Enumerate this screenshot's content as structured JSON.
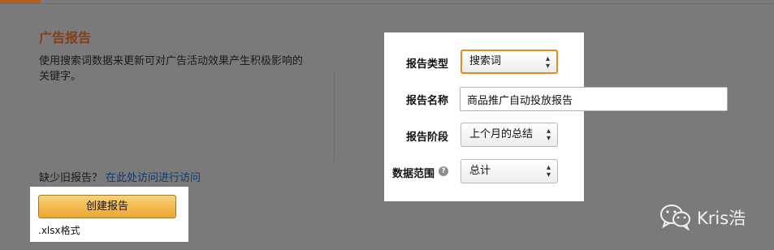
{
  "section": {
    "title": "广告报告",
    "description": "使用搜索词数据来更新可对广告活动效果产生积极影响的关键字。"
  },
  "missing": {
    "text": "缺少旧报告？",
    "link_text": "在此处访问进行访问"
  },
  "create": {
    "button_label": "创建报告",
    "format_note": ".xlsx格式"
  },
  "form": {
    "type_label": "报告类型",
    "type_value": "搜索词",
    "name_label": "报告名称",
    "name_value": "商品推广自动投放报告",
    "period_label": "报告阶段",
    "period_value": "上个月的总结",
    "scope_label": "数据范围",
    "scope_value": "总计",
    "help_glyph": "?"
  },
  "watermark": {
    "text": "Kris浩"
  },
  "colors": {
    "title": "#8a3b12",
    "link": "#0b3a6e",
    "focus_border": "#e88b23",
    "button": "#eda631"
  }
}
